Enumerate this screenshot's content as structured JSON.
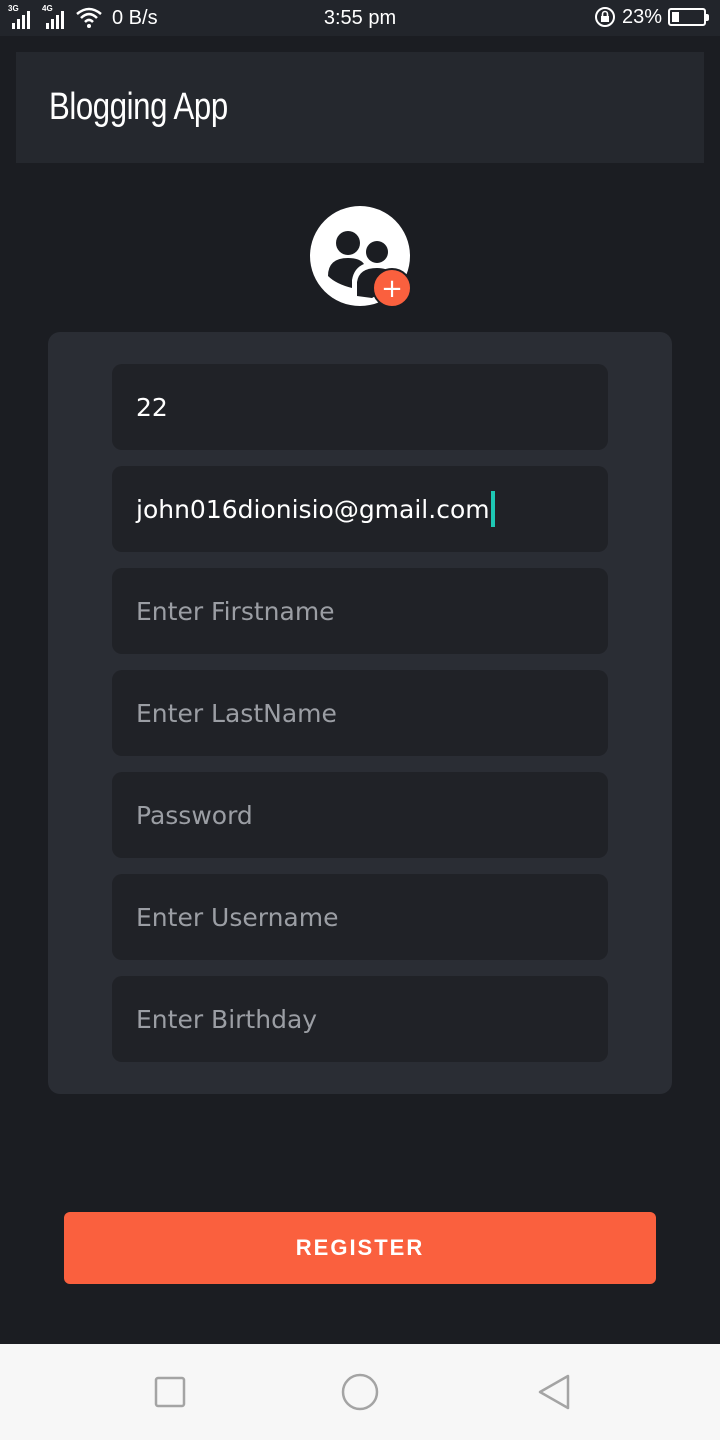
{
  "status_bar": {
    "network_1": "3G",
    "network_2": "4G",
    "speed": "0 B/s",
    "time": "3:55 pm",
    "battery_percent": "23%",
    "battery_level": 0.23,
    "icons": [
      "signal-icon",
      "wifi-icon",
      "rotation-lock-icon",
      "battery-icon"
    ]
  },
  "app_bar": {
    "title": "Blogging App"
  },
  "avatar": {
    "icon": "group-avatar-icon",
    "add_icon": "plus-icon",
    "add_symbol": "+"
  },
  "form": {
    "fields": [
      {
        "name": "age",
        "value": "22",
        "placeholder": ""
      },
      {
        "name": "email",
        "value": "john016dionisio@gmail.com",
        "placeholder": ""
      },
      {
        "name": "firstname",
        "value": "",
        "placeholder": "Enter Firstname"
      },
      {
        "name": "lastname",
        "value": "",
        "placeholder": "Enter LastName"
      },
      {
        "name": "password",
        "value": "",
        "placeholder": "Password"
      },
      {
        "name": "username",
        "value": "",
        "placeholder": "Enter Username"
      },
      {
        "name": "birthday",
        "value": "",
        "placeholder": "Enter Birthday"
      }
    ]
  },
  "register_button": {
    "label": "REGISTER"
  },
  "nav_bar": {
    "icons": [
      "recents-square-icon",
      "home-circle-icon",
      "back-triangle-icon"
    ]
  },
  "colors": {
    "accent": "#fa603e",
    "background": "#1b1d22",
    "card": "#2a2d34",
    "field": "#202227",
    "cursor": "#1ec8b4"
  }
}
